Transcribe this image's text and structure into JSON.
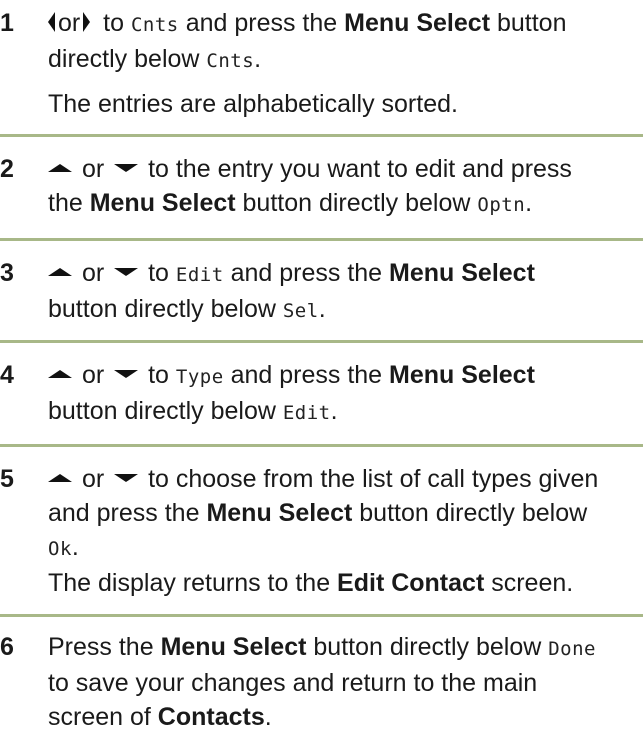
{
  "steps": [
    {
      "number": "1",
      "line1_or": "or",
      "line1_to": " to ",
      "line1_target": "Cnts",
      "line1_press": " and press the ",
      "menu_select": "Menu Select",
      "line1_button": " button",
      "line2_pre": "directly below ",
      "line2_target": "Cnts",
      "line2_post": ".",
      "note": "The entries are alphabetically sorted."
    },
    {
      "number": "2",
      "or": " or ",
      "line1": " to the entry you want to edit and press",
      "line2_pre": "the ",
      "menu_select": "Menu Select",
      "line2_mid": " button directly below ",
      "target": "Optn",
      "line2_post": "."
    },
    {
      "number": "3",
      "or": " or ",
      "to": " to ",
      "target1": "Edit",
      "press": " and press the ",
      "menu_select": "Menu Select",
      "line2_pre": "button directly below ",
      "target2": "Sel",
      "line2_post": "."
    },
    {
      "number": "4",
      "or": " or ",
      "to": " to ",
      "target1": "Type",
      "press": " and press the ",
      "menu_select": "Menu Select",
      "line2_pre": "button directly below ",
      "target2": "Edit",
      "line2_post": "."
    },
    {
      "number": "5",
      "or": " or ",
      "line1": " to choose from the list of call types given",
      "line2_pre": "and press the ",
      "menu_select": "Menu Select",
      "line2_post": " button directly below",
      "target": "Ok",
      "line3_post": ".",
      "note_pre": "The display returns to the ",
      "note_bold": "Edit Contact",
      "note_post": " screen."
    },
    {
      "number": "6",
      "line1_pre": "Press the ",
      "menu_select": "Menu Select",
      "line1_mid": " button directly below ",
      "target": "Done",
      "line2": "to save your changes and return to the main",
      "line3_pre": "screen of ",
      "contacts": "Contacts",
      "line3_post": "."
    }
  ],
  "icons": {
    "left_arrow": "left-arrow-icon",
    "right_arrow": "right-arrow-icon",
    "up_arrow": "up-arrow-icon",
    "down_arrow": "down-arrow-icon"
  },
  "separator_color": "#a8b888"
}
